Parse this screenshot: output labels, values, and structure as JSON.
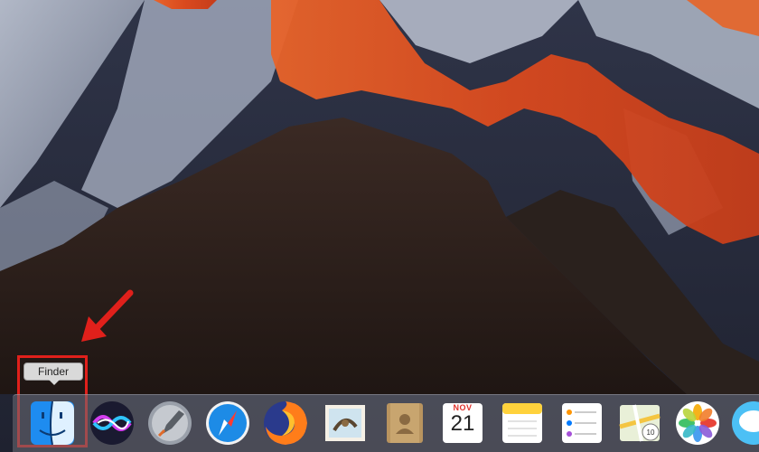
{
  "desktop": {
    "wallpaper": "sierra-mountains-sunset"
  },
  "tooltip": {
    "label": "Finder"
  },
  "dock": {
    "items": [
      {
        "name": "Finder",
        "icon": "finder-icon"
      },
      {
        "name": "Siri",
        "icon": "siri-icon"
      },
      {
        "name": "Launchpad",
        "icon": "launchpad-icon"
      },
      {
        "name": "Safari",
        "icon": "safari-icon"
      },
      {
        "name": "Firefox",
        "icon": "firefox-icon"
      },
      {
        "name": "Mail",
        "icon": "mail-icon"
      },
      {
        "name": "Contacts",
        "icon": "contacts-icon"
      },
      {
        "name": "Calendar",
        "icon": "calendar-icon"
      },
      {
        "name": "Notes",
        "icon": "notes-icon"
      },
      {
        "name": "Reminders",
        "icon": "reminders-icon"
      },
      {
        "name": "Maps",
        "icon": "maps-icon"
      },
      {
        "name": "Photos",
        "icon": "photos-icon"
      },
      {
        "name": "Messages",
        "icon": "messages-icon"
      }
    ],
    "calendar": {
      "month": "NOV",
      "day": "21"
    }
  },
  "annotation": {
    "highlight_color": "#e0201b"
  }
}
